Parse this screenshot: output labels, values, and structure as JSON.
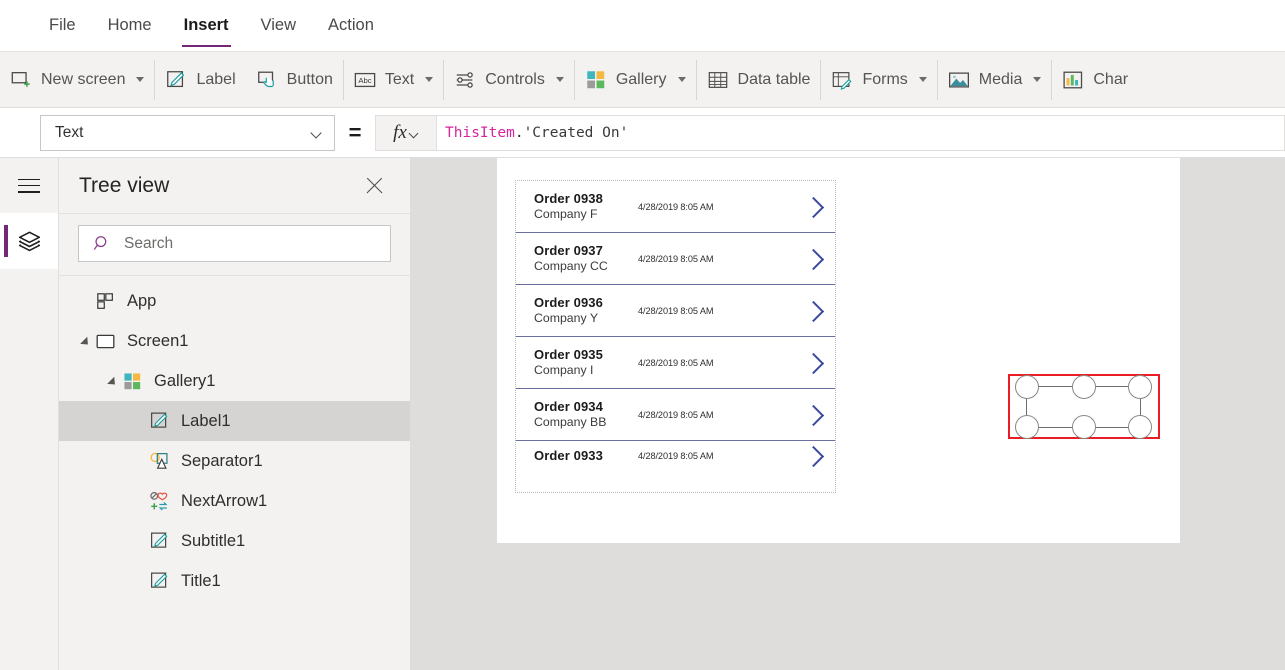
{
  "menubar": {
    "items": [
      {
        "label": "File",
        "active": false
      },
      {
        "label": "Home",
        "active": false
      },
      {
        "label": "Insert",
        "active": true
      },
      {
        "label": "View",
        "active": false
      },
      {
        "label": "Action",
        "active": false
      }
    ]
  },
  "ribbon": {
    "items": [
      {
        "label": "New screen",
        "icon": "new-screen-icon",
        "caret": true
      },
      {
        "label": "Label",
        "icon": "label-icon",
        "caret": false
      },
      {
        "label": "Button",
        "icon": "button-icon",
        "caret": false
      },
      {
        "label": "Text",
        "icon": "text-abc-icon",
        "caret": true
      },
      {
        "label": "Controls",
        "icon": "controls-sliders-icon",
        "caret": true
      },
      {
        "label": "Gallery",
        "icon": "gallery-grid-icon",
        "caret": true
      },
      {
        "label": "Data table",
        "icon": "data-table-icon",
        "caret": false
      },
      {
        "label": "Forms",
        "icon": "forms-icon",
        "caret": true
      },
      {
        "label": "Media",
        "icon": "media-image-icon",
        "caret": true
      },
      {
        "label": "Char",
        "icon": "charts-icon",
        "caret": false
      }
    ]
  },
  "formulabar": {
    "property_value": "Text",
    "equals": "=",
    "fx_label": "fx",
    "formula": {
      "token_object": "ThisItem",
      "token_dot": ".",
      "token_field": "'Created On'"
    }
  },
  "rail": {
    "menu_icon": "hamburger-icon",
    "tree_icon": "layers-icon",
    "accent_color": "#742774"
  },
  "treeview": {
    "title": "Tree view",
    "close_icon": "close-icon",
    "search": {
      "placeholder": "Search",
      "icon": "search-icon"
    },
    "items": [
      {
        "label": "App",
        "icon": "app-icon",
        "depth": 0,
        "twisty": "none",
        "selected": false
      },
      {
        "label": "Screen1",
        "icon": "screen-icon",
        "depth": 0,
        "twisty": "expanded",
        "selected": false
      },
      {
        "label": "Gallery1",
        "icon": "gallery-icon",
        "depth": 1,
        "twisty": "expanded",
        "selected": false
      },
      {
        "label": "Label1",
        "icon": "label-icon",
        "depth": 2,
        "twisty": "none",
        "selected": true
      },
      {
        "label": "Separator1",
        "icon": "separator-icon",
        "depth": 2,
        "twisty": "none",
        "selected": false
      },
      {
        "label": "NextArrow1",
        "icon": "next-arrow-icon",
        "depth": 2,
        "twisty": "none",
        "selected": false
      },
      {
        "label": "Subtitle1",
        "icon": "label-icon",
        "depth": 2,
        "twisty": "none",
        "selected": false
      },
      {
        "label": "Title1",
        "icon": "label-icon",
        "depth": 2,
        "twisty": "none",
        "selected": false
      }
    ]
  },
  "canvas": {
    "background": "#dedddc",
    "screen_background": "#ffffff",
    "gallery": {
      "rows": [
        {
          "title": "Order 0938",
          "subtitle": "Company F",
          "date": "4/28/2019 8:05 AM",
          "chevron": "chevron-right-icon",
          "clipped": false
        },
        {
          "title": "Order 0937",
          "subtitle": "Company CC",
          "date": "4/28/2019 8:05 AM",
          "chevron": "chevron-right-icon",
          "clipped": false
        },
        {
          "title": "Order 0936",
          "subtitle": "Company Y",
          "date": "4/28/2019 8:05 AM",
          "chevron": "chevron-right-icon",
          "clipped": false
        },
        {
          "title": "Order 0935",
          "subtitle": "Company I",
          "date": "4/28/2019 8:05 AM",
          "chevron": "chevron-right-icon",
          "clipped": false
        },
        {
          "title": "Order 0934",
          "subtitle": "Company BB",
          "date": "4/28/2019 8:05 AM",
          "chevron": "chevron-right-icon",
          "clipped": false
        },
        {
          "title": "Order 0933",
          "subtitle": "",
          "date": "4/28/2019 8:05 AM",
          "chevron": "chevron-right-icon",
          "clipped": true
        }
      ]
    },
    "selection": {
      "highlight_color": "#ec1c24",
      "handle_count": 6
    }
  }
}
